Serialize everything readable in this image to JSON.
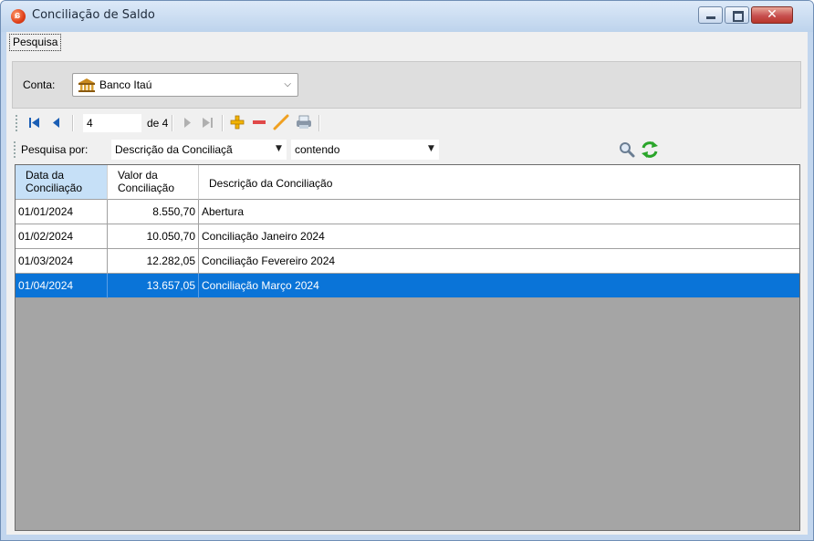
{
  "window": {
    "title": "Conciliação de Saldo",
    "close_glyph": "✕"
  },
  "menu": {
    "pesquisa_label": "Pesquisa"
  },
  "conta": {
    "label": "Conta:",
    "value": "Banco Itaú",
    "icon": "bank-icon"
  },
  "navigator": {
    "position": "4",
    "of_label": "de 4",
    "icons": [
      "move-first-icon",
      "move-previous-icon",
      "move-next-icon",
      "move-last-icon",
      "add-icon",
      "delete-icon",
      "edit-icon",
      "print-icon"
    ]
  },
  "search": {
    "label": "Pesquisa por:",
    "field_value": "Descrição da Conciliaçã",
    "mode_value": "contendo",
    "icons": [
      "search-icon",
      "refresh-icon"
    ]
  },
  "grid": {
    "columns": [
      {
        "line1": "Data da",
        "line2": "Conciliação"
      },
      {
        "line1": "Valor da",
        "line2": "Conciliação"
      },
      {
        "line1": "Descrição da Conciliação",
        "line2": ""
      }
    ],
    "rows": [
      {
        "data": "01/01/2024",
        "valor": "8.550,70",
        "descricao": "Abertura"
      },
      {
        "data": "01/02/2024",
        "valor": "10.050,70",
        "descricao": "Conciliação Janeiro 2024"
      },
      {
        "data": "01/03/2024",
        "valor": "12.282,05",
        "descricao": "Conciliação Fevereiro 2024"
      },
      {
        "data": "01/04/2024",
        "valor": "13.657,05",
        "descricao": "Conciliação Março 2024"
      }
    ],
    "selected_row": 3
  },
  "colors": {
    "selection": "#0a74d8",
    "header_active": "#c6e0f7",
    "grid_background": "#a5a5a5",
    "add_icon": "#f2b400",
    "delete_icon": "#e04848",
    "edit_icon": "#f0a020",
    "refresh_icon": "#2aa52a"
  }
}
